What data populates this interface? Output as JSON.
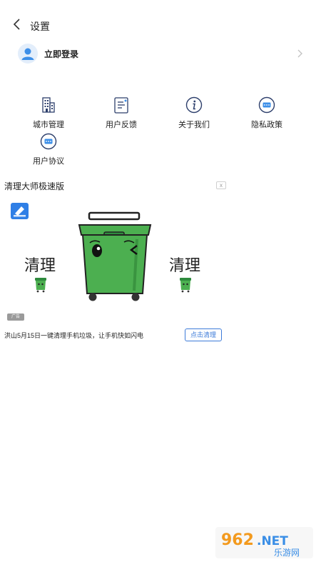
{
  "header": {
    "title": "设置"
  },
  "login": {
    "label": "立即登录"
  },
  "menu": {
    "items": [
      {
        "label": "城市管理",
        "icon": "building-icon"
      },
      {
        "label": "用户反馈",
        "icon": "feedback-icon"
      },
      {
        "label": "关于我们",
        "icon": "info-icon"
      },
      {
        "label": "隐私政策",
        "icon": "message-icon"
      },
      {
        "label": "用户协议",
        "icon": "message-icon"
      }
    ]
  },
  "ad": {
    "title": "清理大师极速版",
    "close_label": "x",
    "clean_left": "清理",
    "clean_right": "清理",
    "tag": "广告",
    "description": "洪山5月15日一键清理手机垃圾，让手机快如闪电",
    "button_label": "点击清理"
  },
  "watermark": {
    "brand": "962.NET",
    "subtitle": "乐游网"
  },
  "colors": {
    "accent": "#3d7bd9",
    "bin_green": "#4caf50",
    "avatar_bg": "#e3eefb",
    "icon_stroke": "#2c3e6b"
  }
}
